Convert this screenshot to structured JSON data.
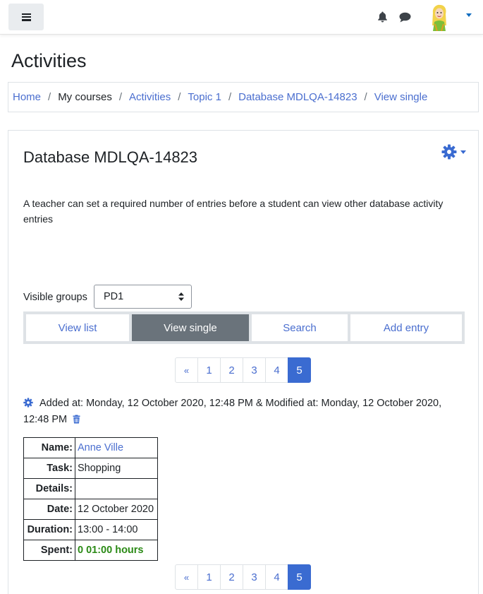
{
  "navbar": {
    "menu_icon": "hamburger-icon",
    "notifications_icon": "bell-icon",
    "messages_icon": "chat-bubble-icon",
    "avatar_icon": "user-avatar",
    "user_menu_icon": "chevron-down-icon"
  },
  "page": {
    "heading": "Activities"
  },
  "breadcrumb": [
    {
      "label": "Home",
      "link": true
    },
    {
      "label": "My courses",
      "link": false
    },
    {
      "label": "Activities",
      "link": true
    },
    {
      "label": "Topic 1",
      "link": true
    },
    {
      "label": "Database MDLQA-14823",
      "link": true
    },
    {
      "label": "View single",
      "link": true
    }
  ],
  "breadcrumb_separator": "/",
  "card": {
    "title": "Database MDLQA-14823",
    "settings_icon": "gear-icon",
    "intro": "A teacher can set a required number of entries before a student can view other database activity entries"
  },
  "groups": {
    "label": "Visible groups",
    "selected": "PD1"
  },
  "tabs": [
    {
      "label": "View list",
      "active": false
    },
    {
      "label": "View single",
      "active": true
    },
    {
      "label": "Search",
      "active": false
    },
    {
      "label": "Add entry",
      "active": false
    }
  ],
  "pagination": {
    "prev": "«",
    "pages": [
      "1",
      "2",
      "3",
      "4",
      "5"
    ],
    "current": "5"
  },
  "entry": {
    "meta_text": "Added at: Monday, 12 October 2020, 12:48 PM & Modified at: Monday, 12 October 2020, 12:48 PM",
    "edit_icon": "gear-icon",
    "delete_icon": "trash-icon",
    "fields": {
      "name_label": "Name:",
      "name_value": "Anne Ville",
      "task_label": "Task:",
      "task_value": "Shopping",
      "details_label": "Details:",
      "details_value": "",
      "date_label": "Date:",
      "date_value": "12 October 2020",
      "duration_label": "Duration:",
      "duration_value": "13:00 - 14:00",
      "spent_label": "Spent:",
      "spent_value": "0 01:00 hours"
    }
  },
  "colors": {
    "link": "#4a6ecf",
    "primary": "#3a6bd1",
    "active_tab": "#6a737b",
    "spent_green": "#2b8a16"
  }
}
